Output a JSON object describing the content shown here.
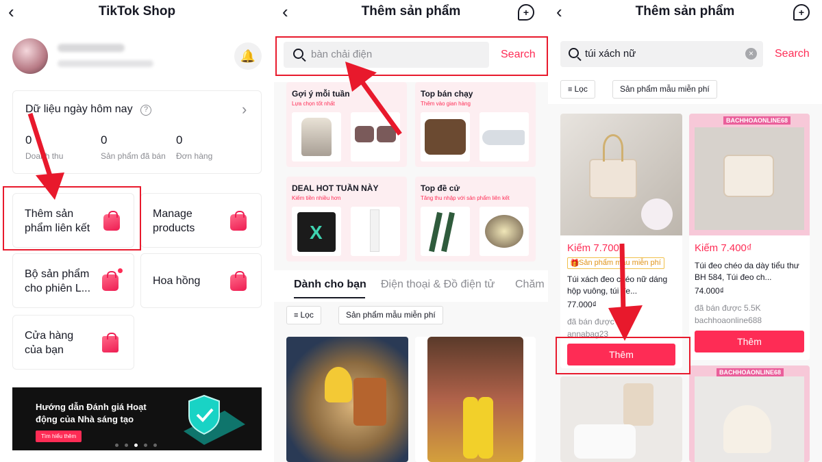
{
  "panel1": {
    "title": "TikTok Shop",
    "today_label": "Dữ liệu ngày hôm nay",
    "stats": [
      {
        "value": "0",
        "label": "Doanh thu"
      },
      {
        "value": "0",
        "label": "Sản phẩm đã bán"
      },
      {
        "value": "0",
        "label": "Đơn hàng"
      }
    ],
    "tiles": {
      "add_linked": "Thêm sản phẩm liên kết",
      "manage": "Manage products",
      "live_set": "Bộ sản phẩm cho phiên L...",
      "commission": "Hoa hồng",
      "your_store": "Cửa hàng của bạn"
    },
    "banner": {
      "title": "Hướng dẫn Đánh giá Hoạt động của Nhà sáng tạo",
      "button": "Tìm hiểu thêm"
    }
  },
  "panel2": {
    "title": "Thêm sản phẩm",
    "search_placeholder": "bàn chải điện",
    "search_button": "Search",
    "categories": [
      {
        "title": "Gợi ý mỗi tuần",
        "sub": "Lựa chọn tốt nhất"
      },
      {
        "title": "Top bán chạy",
        "sub": "Thêm vào gian hàng"
      },
      {
        "title": "DEAL HOT TUẦN NÀY",
        "sub": "Kiếm tiền nhiều hơn"
      },
      {
        "title": "Top đề cử",
        "sub": "Tăng thu nhập với sản phẩm liên kết"
      }
    ],
    "tabs": [
      "Dành cho bạn",
      "Điện thoại & Đồ điện tử",
      "Chăm"
    ],
    "filter_label": "Lọc",
    "free_sample": "Sản phẩm mẫu miễn phí"
  },
  "panel3": {
    "title": "Thêm sản phẩm",
    "search_value": "túi xách nữ",
    "search_button": "Search",
    "filter_label": "Lọc",
    "free_sample": "Sản phẩm mẫu miễn phí",
    "products": [
      {
        "earn": "Kiếm 7.700₫",
        "badge": "Sản phẩm mẫu miễn phí",
        "name": "Túi xách đeo chéo nữ dáng hộp vuông, túi đe...",
        "price": "77.000₫",
        "sold": "đã bán được 1.3K",
        "shop": "annabag23",
        "button": "Thêm"
      },
      {
        "earn": "Kiếm 7.400₫",
        "name": "Túi đeo chéo da dày tiểu thư BH 584, Túi đeo ch...",
        "price": "74.000₫",
        "sold": "đã bán được 5.5K",
        "shop": "bachhoaonline688",
        "button": "Thêm"
      }
    ],
    "shop_tag": "BACHHOAONLINE68"
  },
  "colors": {
    "accent": "#fe2c55",
    "annotation": "#e8192c"
  }
}
